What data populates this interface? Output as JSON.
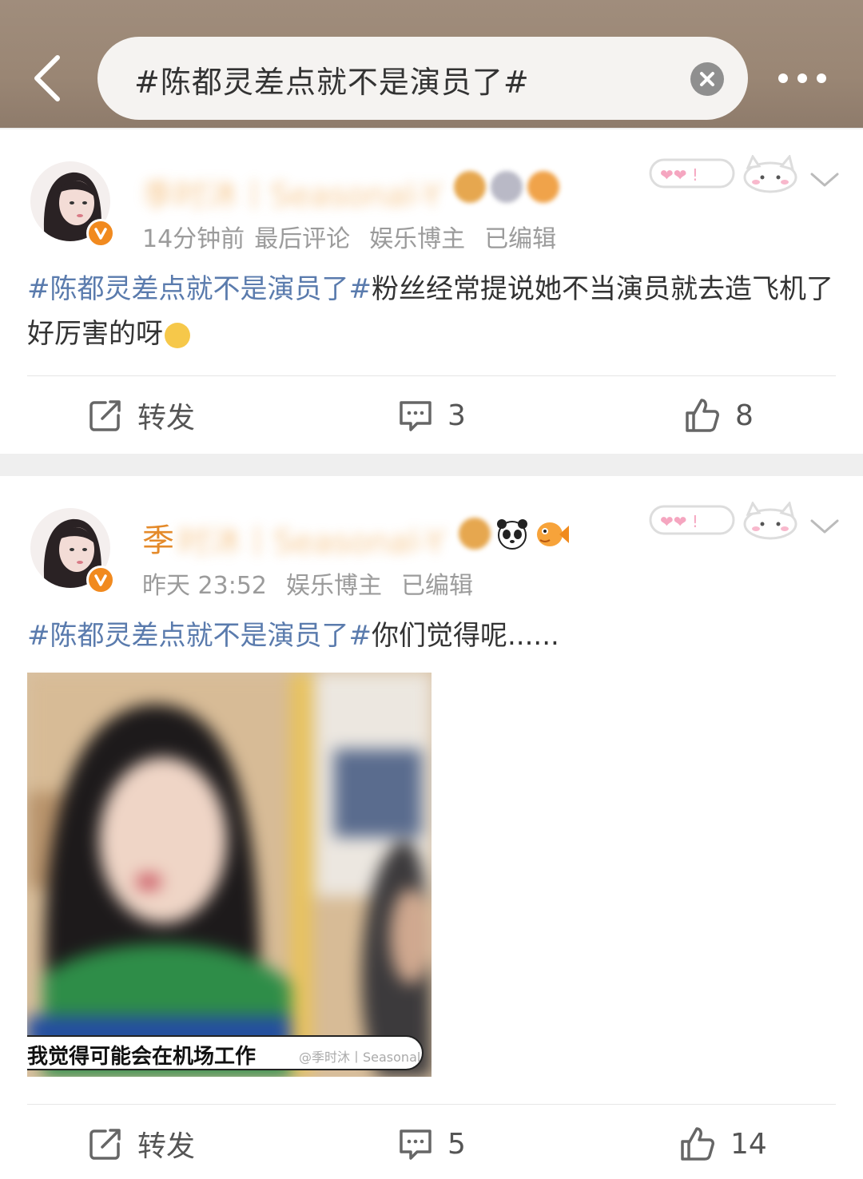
{
  "search": {
    "query": "#陈都灵差点就不是演员了#"
  },
  "posts": [
    {
      "username_visible": "",
      "username_blurred": "季时沐丨Seasonal-Y",
      "time": "14分钟前",
      "meta_extra": "最后评论",
      "category": "娱乐博主",
      "edited": "已编辑",
      "hashtag": "#陈都灵差点就不是演员了#",
      "text": "粉丝经常提说她不当演员就去造飞机了 好厉害的呀",
      "actions": {
        "repost_label": "转发",
        "comments": "3",
        "likes": "8"
      }
    },
    {
      "username_visible": "季",
      "username_blurred": "时沐丨Seasonal-Y",
      "time": "昨天 23:52",
      "category": "娱乐博主",
      "edited": "已编辑",
      "hashtag": "#陈都灵差点就不是演员了#",
      "text": "你们觉得呢......",
      "image_caption": "我觉得可能会在机场工作",
      "image_watermark": "@季时沐丨Seasonal",
      "actions": {
        "repost_label": "转发",
        "comments": "5",
        "likes": "14"
      }
    }
  ],
  "colors": {
    "accent_orange": "#f18a1f",
    "hashtag_blue": "#5a7bad",
    "topbar": "#9a8674"
  },
  "icons": [
    "back-arrow-icon",
    "clear-icon",
    "more-icon",
    "verified-badge-icon",
    "chevron-down-icon",
    "repost-icon",
    "comment-icon",
    "like-icon",
    "panda-icon",
    "fish-icon"
  ]
}
